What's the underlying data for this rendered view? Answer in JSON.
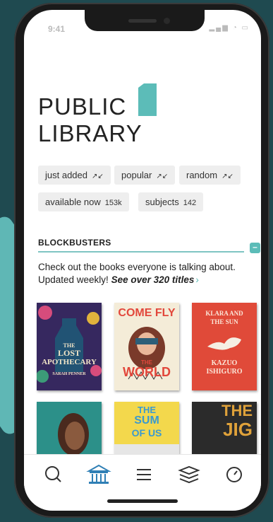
{
  "status": {
    "time": "9:41"
  },
  "title": {
    "line1": "PUBLIC",
    "line2": "LIBRARY"
  },
  "filters": {
    "sort": [
      {
        "label": "just added"
      },
      {
        "label": "popular"
      },
      {
        "label": "random"
      }
    ],
    "available": {
      "label": "available now",
      "count": "153k"
    },
    "subjects": {
      "label": "subjects",
      "count": "142"
    }
  },
  "section": {
    "title": "BLOCKBUSTERS",
    "collapse_symbol": "–",
    "description": "Check out the books everyone is talking about. Updated weekly!",
    "see_over": "See over 320 titles"
  },
  "books": [
    {
      "title_line1": "THE",
      "title_line2": "LOST",
      "title_line3": "APOTHECARY",
      "author": "SARAH PENNER"
    },
    {
      "title_line1": "COME FLY",
      "title_line2": "THE",
      "title_line3": "WORLD",
      "author": ""
    },
    {
      "title_line1": "KLARA AND",
      "title_line2": "THE SUN",
      "title_line3": "KAZUO",
      "author": "ISHIGURO"
    },
    {
      "title_line1": "",
      "title_line2": "",
      "title_line3": "",
      "author": ""
    },
    {
      "title_line1": "THE",
      "title_line2": "SUM",
      "title_line3": "OF US",
      "author": ""
    },
    {
      "title_line1": "THE",
      "title_line2": "JIG",
      "title_line3": "",
      "author": ""
    }
  ],
  "tabs": [
    {
      "icon": "search-icon"
    },
    {
      "icon": "library-icon"
    },
    {
      "icon": "menu-icon"
    },
    {
      "icon": "books-icon"
    },
    {
      "icon": "clock-icon"
    }
  ],
  "colors": {
    "accent": "#5cbcb8",
    "text": "#222222",
    "tag_bg": "#eeeeee"
  }
}
